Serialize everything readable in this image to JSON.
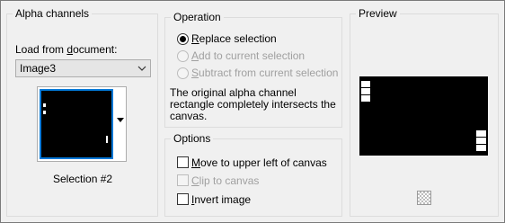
{
  "alpha": {
    "title": "Alpha channels",
    "load_label_pre": "Load from ",
    "load_label_u": "d",
    "load_label_post": "ocument:",
    "document_value": "Image3",
    "selection_label": "Selection #2"
  },
  "operation": {
    "title": "Operation",
    "replace_u": "R",
    "replace_rest": "eplace selection",
    "add_u": "A",
    "add_rest": "dd to current selection",
    "subtract_u": "S",
    "subtract_rest": "ubtract from current selection",
    "description": "The original alpha channel rectangle completely intersects the canvas."
  },
  "options": {
    "title": "Options",
    "move_u": "M",
    "move_rest": "ove to upper left of canvas",
    "clip_u": "C",
    "clip_rest": "lip to canvas",
    "invert_u": "I",
    "invert_rest": "nvert image"
  },
  "preview": {
    "title": "Preview"
  },
  "state": {
    "replace_selected": true,
    "add_enabled": false,
    "subtract_enabled": false,
    "move_checked": false,
    "clip_enabled": false,
    "invert_checked": false
  }
}
